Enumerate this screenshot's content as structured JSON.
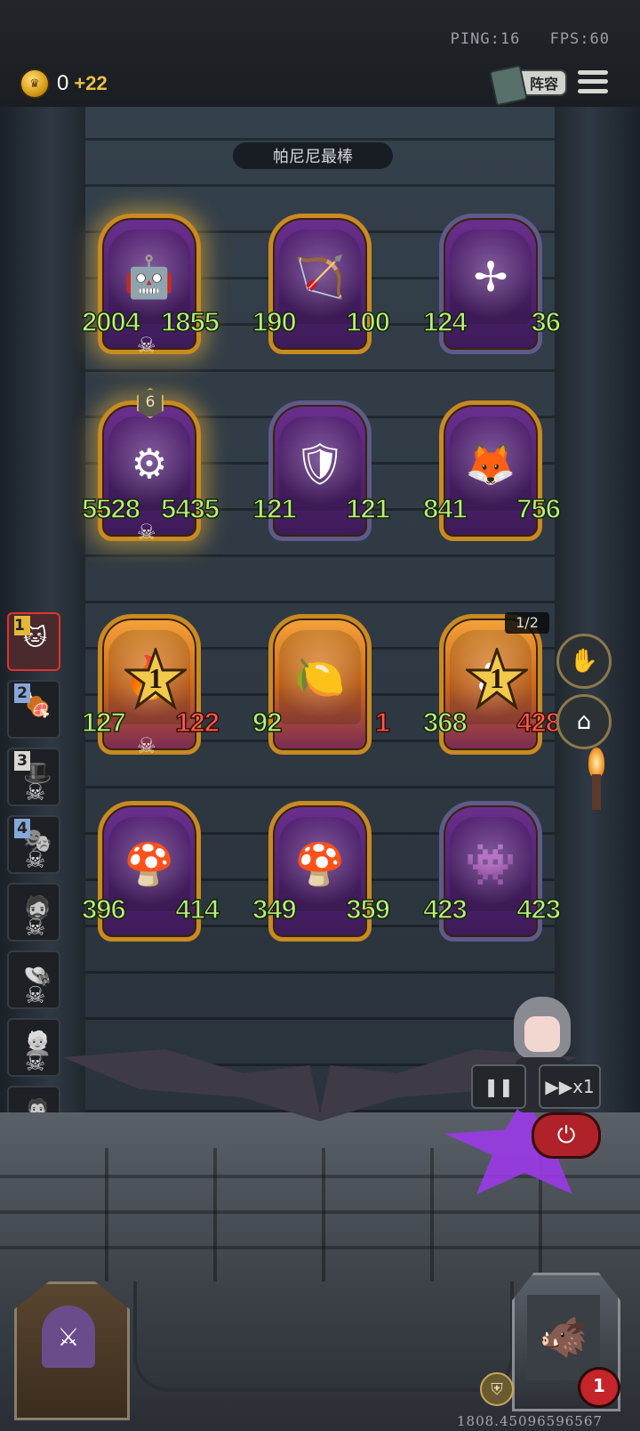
{
  "hud": {
    "ping": "PING:16",
    "fps": "FPS:60",
    "gold_value": "0",
    "gold_income": "+22",
    "lineup_label": "阵容"
  },
  "opponent_name": "帕尼尼最棒",
  "board": [
    {
      "row": 1,
      "col": 1,
      "atk": "2004",
      "hp": "1855",
      "portrait": "robot-knight",
      "frame": "gold-glow",
      "skull": true
    },
    {
      "row": 1,
      "col": 2,
      "atk": "190",
      "hp": "100",
      "portrait": "hooded-ranger",
      "frame": "gold"
    },
    {
      "row": 1,
      "col": 3,
      "atk": "124",
      "hp": "36",
      "portrait": "windmill",
      "frame": "purple"
    },
    {
      "row": 2,
      "col": 1,
      "atk": "5528",
      "hp": "5435",
      "portrait": "brass-golem",
      "frame": "gold-glow",
      "skull": true,
      "level": "6"
    },
    {
      "row": 2,
      "col": 2,
      "atk": "121",
      "hp": "121",
      "portrait": "iron-knight",
      "frame": "purple"
    },
    {
      "row": 2,
      "col": 3,
      "atk": "841",
      "hp": "756",
      "portrait": "masked-fox",
      "frame": "gold"
    },
    {
      "row": 3,
      "col": 1,
      "atk": "127",
      "hp": "122",
      "portrait": "fire-spirit",
      "frame": "fire",
      "star": "1",
      "hp_damaged": true,
      "skull": true
    },
    {
      "row": 3,
      "col": 2,
      "atk": "92",
      "hp": "1",
      "portrait": "lemon-sprite",
      "frame": "fire",
      "hp_damaged": true
    },
    {
      "row": 3,
      "col": 3,
      "atk": "368",
      "hp": "428",
      "portrait": "flower-burst",
      "frame": "fire",
      "star": "1",
      "hp_damaged": true
    },
    {
      "row": 4,
      "col": 1,
      "atk": "396",
      "hp": "414",
      "portrait": "mushroom-girl",
      "frame": "gold"
    },
    {
      "row": 4,
      "col": 2,
      "atk": "349",
      "hp": "359",
      "portrait": "mushroom-girl",
      "frame": "gold"
    },
    {
      "row": 4,
      "col": 3,
      "atk": "423",
      "hp": "423",
      "portrait": "goggle-gremlin",
      "frame": "purple"
    }
  ],
  "page_indicator": "1/2",
  "star_badge_label": "1",
  "players": [
    {
      "rank": "1",
      "active": true
    },
    {
      "rank": "2"
    },
    {
      "rank": "3",
      "eliminated": true
    },
    {
      "rank": "4",
      "eliminated": true
    },
    {
      "rank": "",
      "eliminated": true
    },
    {
      "rank": "",
      "eliminated": true
    },
    {
      "rank": "",
      "eliminated": true
    },
    {
      "rank": "",
      "eliminated": true
    }
  ],
  "controls": {
    "pause_icon": "pause-icon",
    "speed_label": "x1"
  },
  "life": "1",
  "coordinate_readout": "1808.45096596567",
  "colors": {
    "stat_green": "#b8f07a",
    "stat_red": "#ff5a4a",
    "gold_frame": "#c88a22",
    "purple_frame": "#5e5a8a",
    "power_red": "#b0222a"
  }
}
